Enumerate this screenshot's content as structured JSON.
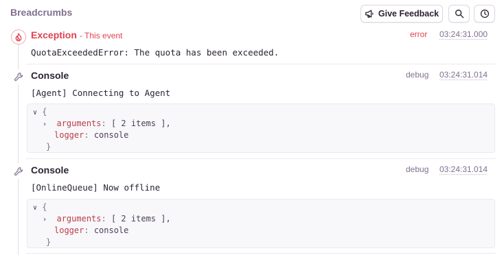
{
  "header": {
    "title": "Breadcrumbs",
    "feedback_label": "Give Feedback"
  },
  "crumbs": [
    {
      "type": "Exception",
      "subtitle": "- This event",
      "level": "error",
      "timestamp": "03:24:31.000",
      "message": "QuotaExceededError: The quota has been exceeded."
    },
    {
      "type": "Console",
      "level": "debug",
      "timestamp": "03:24:31.014",
      "message": "[Agent] Connecting to Agent",
      "data": {
        "open": "{",
        "arguments_key": "arguments",
        "arguments_val": "[ 2 items ],",
        "logger_key": "logger",
        "logger_val": "console",
        "close": "}"
      }
    },
    {
      "type": "Console",
      "level": "debug",
      "timestamp": "03:24:31.014",
      "message": "[OnlineQueue] Now offline",
      "data": {
        "open": "{",
        "arguments_key": "arguments",
        "arguments_val": "[ 2 items ],",
        "logger_key": "logger",
        "logger_val": "console",
        "close": "}"
      }
    }
  ],
  "icons": {
    "feedback": "megaphone-icon",
    "search": "search-icon",
    "time": "clock-icon",
    "exception": "fire-icon",
    "console": "wrench-icon"
  },
  "colors": {
    "error": "#e0414f",
    "muted": "#80708f",
    "code_key": "#bb3e4a"
  }
}
